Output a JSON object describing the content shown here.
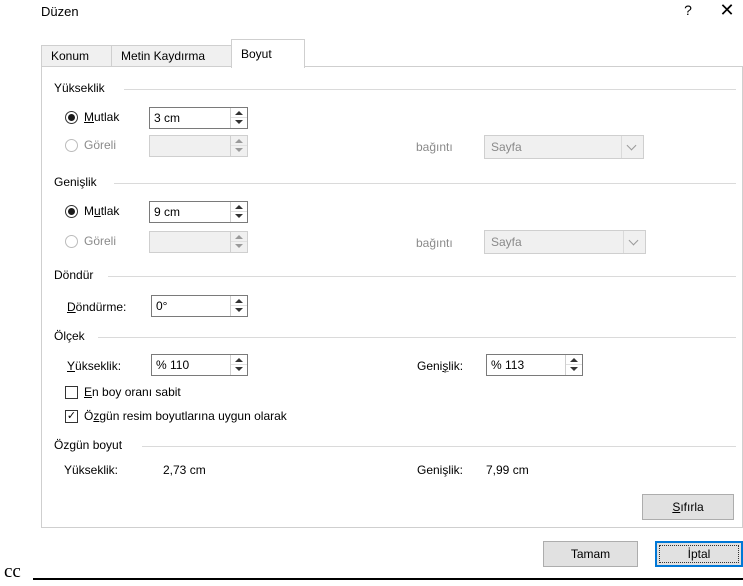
{
  "dialog": {
    "title": "Düzen",
    "help": "?",
    "close": "✕"
  },
  "tabs": [
    {
      "label": "Konum",
      "active": false
    },
    {
      "label": "Metin Kaydırma",
      "active": false
    },
    {
      "label": "Boyut",
      "active": true
    }
  ],
  "height": {
    "section": "Yükseklik",
    "absolute": {
      "label_pre": "",
      "label_u": "M",
      "label_post": "utlak",
      "value": "3 cm",
      "checked": true
    },
    "relative": {
      "label": "Göreli",
      "value": "",
      "disabled": true
    },
    "relation_label": "bağıntı",
    "relation_value": "Sayfa"
  },
  "width": {
    "section": "Genişlik",
    "absolute": {
      "label_pre": "M",
      "label_u": "u",
      "label_post": "tlak",
      "value": "9 cm",
      "checked": true
    },
    "relative": {
      "label": "Göreli",
      "value": "",
      "disabled": true
    },
    "relation_label": "bağıntı",
    "relation_value": "Sayfa"
  },
  "rotate": {
    "section": "Döndür",
    "label_u": "D",
    "label_post": "öndürme:",
    "value": "0°"
  },
  "scale": {
    "section": "Ölçek",
    "height_label_u": "Y",
    "height_label_post": "ükseklik:",
    "height_value": "% 110",
    "width_label_pre": "Geni",
    "width_label_u": "ş",
    "width_label_post": "lik:",
    "width_value": "% 113",
    "lock_aspect": {
      "label_u": "E",
      "label_post": "n boy oranı sabit",
      "checked": false
    },
    "relative_original": {
      "label_pre": "Ö",
      "label_u": "z",
      "label_post": "gün resim boyutlarına uygun olarak",
      "checked": true,
      "check_glyph": "✓"
    }
  },
  "original": {
    "section": "Özgün boyut",
    "height_label": "Yükseklik:",
    "height_value": "2,73 cm",
    "width_label": "Genişlik:",
    "width_value": "7,99 cm"
  },
  "buttons": {
    "reset_u": "S",
    "reset_post": "ıfırla",
    "ok": "Tamam",
    "cancel": "İptal"
  },
  "footer_text": "cc"
}
